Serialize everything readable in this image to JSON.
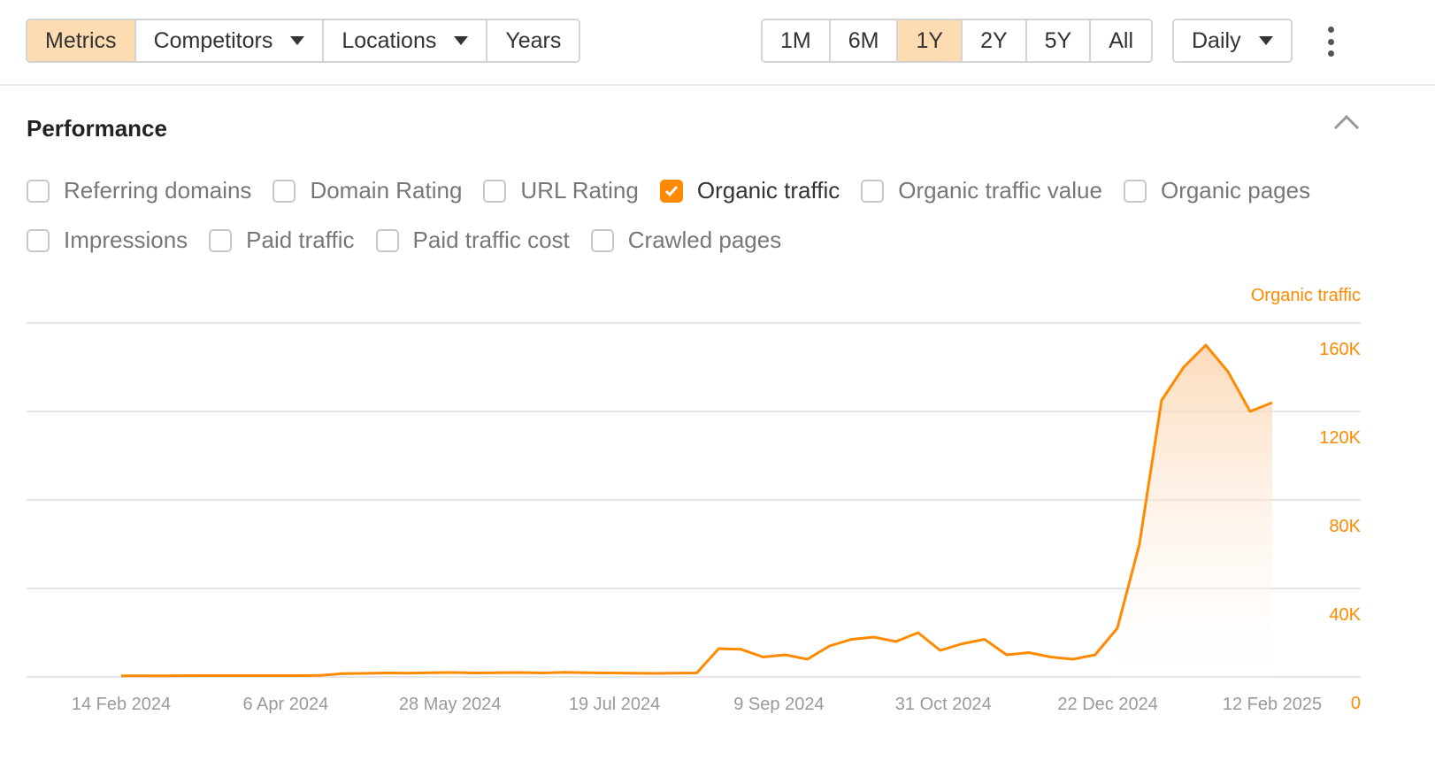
{
  "toolbar": {
    "left": [
      {
        "label": "Metrics",
        "active": true,
        "caret": false
      },
      {
        "label": "Competitors",
        "active": false,
        "caret": true
      },
      {
        "label": "Locations",
        "active": false,
        "caret": true
      },
      {
        "label": "Years",
        "active": false,
        "caret": false
      }
    ],
    "ranges": [
      {
        "label": "1M",
        "active": false
      },
      {
        "label": "6M",
        "active": false
      },
      {
        "label": "1Y",
        "active": true
      },
      {
        "label": "2Y",
        "active": false
      },
      {
        "label": "5Y",
        "active": false
      },
      {
        "label": "All",
        "active": false
      }
    ],
    "interval": "Daily"
  },
  "section": {
    "title": "Performance"
  },
  "metrics_row1": [
    {
      "label": "Referring domains",
      "checked": false
    },
    {
      "label": "Domain Rating",
      "checked": false
    },
    {
      "label": "URL Rating",
      "checked": false
    },
    {
      "label": "Organic traffic",
      "checked": true
    },
    {
      "label": "Organic traffic value",
      "checked": false
    },
    {
      "label": "Organic pages",
      "checked": false
    }
  ],
  "metrics_row2": [
    {
      "label": "Impressions",
      "checked": false
    },
    {
      "label": "Paid traffic",
      "checked": false
    },
    {
      "label": "Paid traffic cost",
      "checked": false
    },
    {
      "label": "Crawled pages",
      "checked": false
    }
  ],
  "colors": {
    "accent": "#ff8a00",
    "active_bg": "#fddcb2"
  },
  "chart_data": {
    "type": "area",
    "series_name": "Organic traffic",
    "x_step_days": 7,
    "x_start": "14 Feb 2024",
    "values": [
      500,
      500,
      500,
      600,
      600,
      600,
      600,
      600,
      600,
      700,
      1500,
      1600,
      1800,
      1700,
      1900,
      2000,
      1800,
      1900,
      2000,
      1800,
      2100,
      1900,
      1800,
      1700,
      1600,
      1700,
      1800,
      12800,
      12500,
      9000,
      10000,
      8000,
      14000,
      17000,
      18000,
      16000,
      20000,
      12000,
      15000,
      17000,
      10000,
      11000,
      9000,
      8000,
      10000,
      22000,
      60000,
      125000,
      140000,
      150000,
      138000,
      120000,
      124000
    ],
    "xticks": [
      "14 Feb 2024",
      "6 Apr 2024",
      "28 May 2024",
      "19 Jul 2024",
      "9 Sep 2024",
      "31 Oct 2024",
      "22 Dec 2024",
      "12 Feb 2025"
    ],
    "xtick_days": [
      0,
      52,
      104,
      156,
      208,
      260,
      312,
      364
    ],
    "yticks": [
      "0",
      "40K",
      "80K",
      "120K",
      "160K"
    ],
    "ytick_values": [
      0,
      40000,
      80000,
      120000,
      160000
    ],
    "ylim": [
      0,
      160000
    ],
    "grid": true,
    "legend": "top-right"
  }
}
